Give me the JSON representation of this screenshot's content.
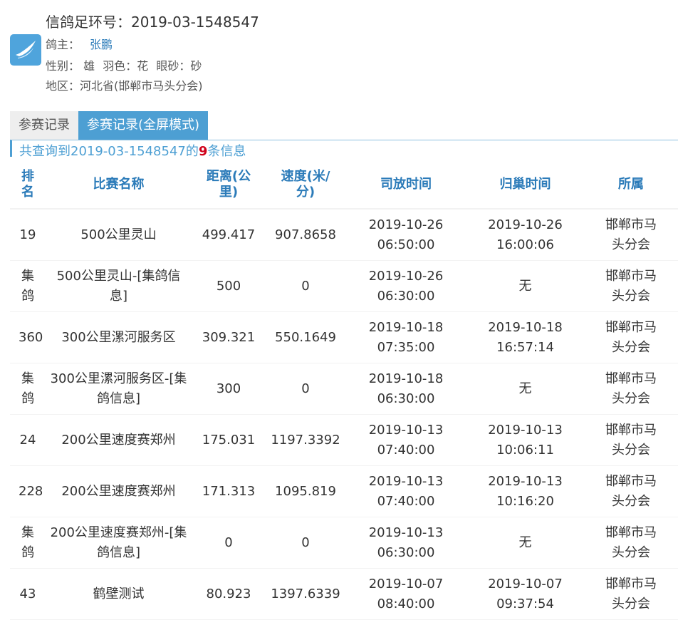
{
  "pigeon": {
    "title": "信鸽足环号：2019-03-1548547",
    "owner_label": "鸽主：",
    "owner": "张鹏",
    "gender_label": "性别：",
    "gender": "雄",
    "plumage_label": "羽色：",
    "plumage": "花",
    "eye_label": "眼砂：",
    "eye": "砂",
    "region_label": "地区：",
    "region": "河北省(邯郸市马头分会)"
  },
  "tabs": [
    {
      "label": "参赛记录"
    },
    {
      "label": "参赛记录(全屏模式)"
    }
  ],
  "summary": {
    "prefix": "共查询到2019-03-1548547的",
    "count": "9",
    "suffix": "条信息"
  },
  "colors": {
    "accent": "#4d9fd3",
    "link": "#2b7bb9",
    "highlight": "#d0021b"
  },
  "table": {
    "headers": [
      "排名",
      "比赛名称",
      "距离(公里)",
      "速度(米/分)",
      "司放时间",
      "归巢时间",
      "所属"
    ],
    "rows": [
      {
        "rank": "19",
        "race": "500公里灵山",
        "distance": "499.417",
        "speed": "907.8658",
        "release": "2019-10-26 06:50:00",
        "arrival": "2019-10-26 16:00:06",
        "club": "邯郸市马头分会"
      },
      {
        "rank": "集鸽",
        "race": "500公里灵山-[集鸽信息]",
        "distance": "500",
        "speed": "0",
        "release": "2019-10-26 06:30:00",
        "arrival": "无",
        "club": "邯郸市马头分会"
      },
      {
        "rank": "360",
        "race": "300公里漯河服务区",
        "distance": "309.321",
        "speed": "550.1649",
        "release": "2019-10-18 07:35:00",
        "arrival": "2019-10-18 16:57:14",
        "club": "邯郸市马头分会"
      },
      {
        "rank": "集鸽",
        "race": "300公里漯河服务区-[集鸽信息]",
        "distance": "300",
        "speed": "0",
        "release": "2019-10-18 06:30:00",
        "arrival": "无",
        "club": "邯郸市马头分会"
      },
      {
        "rank": "24",
        "race": "200公里速度赛郑州",
        "distance": "175.031",
        "speed": "1197.3392",
        "release": "2019-10-13 07:40:00",
        "arrival": "2019-10-13 10:06:11",
        "club": "邯郸市马头分会"
      },
      {
        "rank": "228",
        "race": "200公里速度赛郑州",
        "distance": "171.313",
        "speed": "1095.819",
        "release": "2019-10-13 07:40:00",
        "arrival": "2019-10-13 10:16:20",
        "club": "邯郸市马头分会"
      },
      {
        "rank": "集鸽",
        "race": "200公里速度赛郑州-[集鸽信息]",
        "distance": "0",
        "speed": "0",
        "release": "2019-10-13 06:30:00",
        "arrival": "无",
        "club": "邯郸市马头分会"
      },
      {
        "rank": "43",
        "race": "鹤壁测试",
        "distance": "80.923",
        "speed": "1397.6339",
        "release": "2019-10-07 08:40:00",
        "arrival": "2019-10-07 09:37:54",
        "club": "邯郸市马头分会"
      }
    ]
  }
}
